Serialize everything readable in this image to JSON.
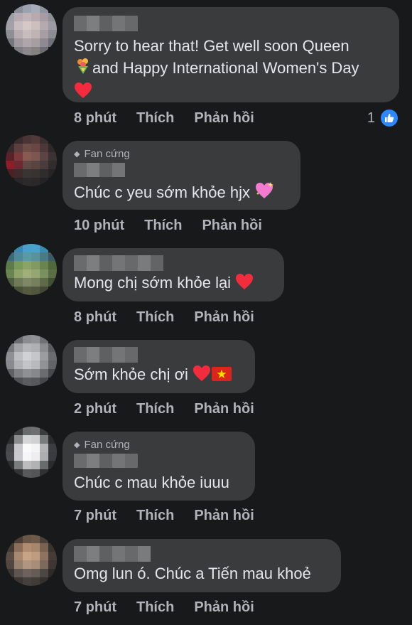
{
  "comments": [
    {
      "text": "Sorry to hear that! Get well soon Queen",
      "text2": "and Happy International Women's Day",
      "time": "8 phút",
      "like": "Thích",
      "reply": "Phản hồi",
      "like_count": "1"
    },
    {
      "badge": "Fan cứng",
      "text": "Chúc c yeu sớm khỏe hjx",
      "time": "10 phút",
      "like": "Thích",
      "reply": "Phản hồi"
    },
    {
      "text": "Mong chị sớm khỏe lại",
      "time": "8 phút",
      "like": "Thích",
      "reply": "Phản hồi"
    },
    {
      "text": "Sớm khỏe chị ơi",
      "time": "2 phút",
      "like": "Thích",
      "reply": "Phản hồi"
    },
    {
      "badge": "Fan cứng",
      "text": "Chúc c mau khỏe iuuu",
      "time": "7 phút",
      "like": "Thích",
      "reply": "Phản hồi"
    },
    {
      "text": "Omg lun ó. Chúc a Tiến mau khoẻ",
      "time": "7 phút",
      "like": "Thích",
      "reply": "Phản hồi"
    }
  ],
  "icons": {
    "bouquet": "bouquet-icon",
    "heart": "heart-icon",
    "sparkling_heart": "sparkling-heart-icon",
    "vn_flag": "vietnam-flag-icon",
    "like_thumb": "like-thumb-icon",
    "diamond": "diamond-icon"
  },
  "colors": {
    "background": "#18191a",
    "bubble": "#3a3b3c",
    "text": "#e4e6eb",
    "secondary": "#b0b3b8",
    "like_blue": "#2d88ff"
  }
}
